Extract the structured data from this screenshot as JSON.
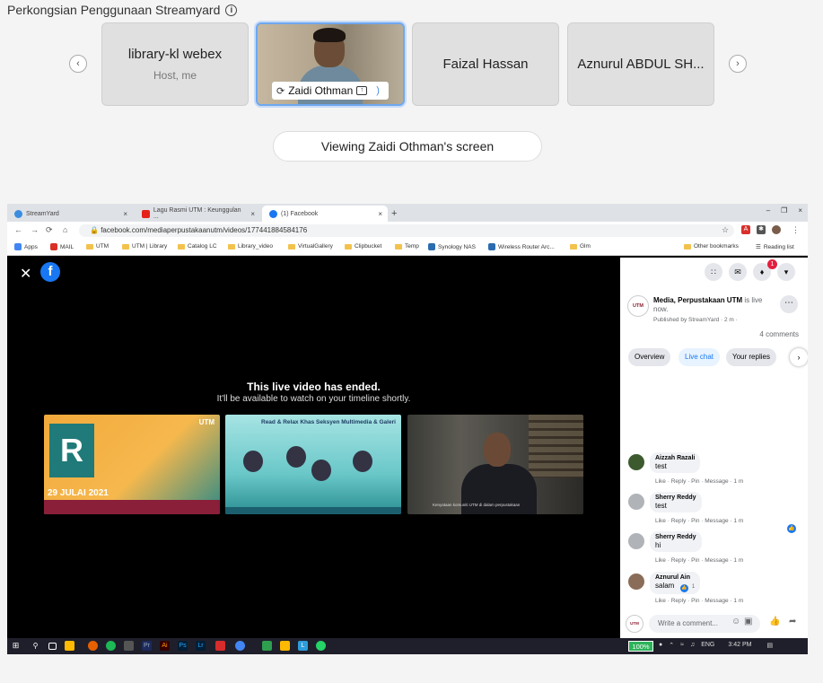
{
  "header": {
    "title": "Perkongsian Penggunaan Streamyard"
  },
  "participants": [
    {
      "name": "library-kl webex",
      "role": "Host, me"
    },
    {
      "name": "Zaidi Othman"
    },
    {
      "name": "Faizal Hassan"
    },
    {
      "name": "Aznurul ABDUL SH..."
    }
  ],
  "viewing_label": "Viewing Zaidi Othman's screen",
  "browser": {
    "tabs": [
      "StreamYard",
      "Lagu Rasmi UTM : Keunggulan ...",
      "(1) Facebook"
    ],
    "url": "facebook.com/mediaperpustakaanutm/videos/177441884584176",
    "bookmarks": [
      "Apps",
      "MAIL",
      "UTM",
      "UTM | Library",
      "Catalog LC",
      "Library_video",
      "VirtualGallery",
      "Clipbucket",
      "Temp",
      "Synology NAS",
      "Wireless Router Arc...",
      "Glm"
    ],
    "bookmarks_right": [
      "Other bookmarks",
      "Reading list"
    ]
  },
  "video": {
    "ended_title": "This live video has ended.",
    "ended_sub": "It'll be available to watch on your timeline shortly.",
    "thumb1": {
      "utm": "UTM",
      "logo": "R",
      "date": "29 JULAI 2021"
    },
    "thumb2": {
      "title": "Read & Relax Khas Seksyen Multimedia & Galeri"
    },
    "thumb3": {
      "caption": "Kenyataan komuniti UTM di dalam perpustakaan"
    }
  },
  "sidebar": {
    "notif_count": "1",
    "post": {
      "logo": "UTM",
      "author": "Media, Perpustakaan UTM",
      "status": "is live now.",
      "meta": "Published by StreamYard · 2 m ·"
    },
    "comment_count": "4 comments",
    "pills": [
      "Overview",
      "Live chat",
      "Your replies"
    ],
    "comments": [
      {
        "author": "Aizzah Razali",
        "text": "test",
        "actions": "Like · Reply · Pin · Message · 1 m"
      },
      {
        "author": "Sherry Reddy",
        "text": "test",
        "actions": "Like · Reply · Pin · Message · 1 m"
      },
      {
        "author": "Sherry Reddy",
        "text": "hi",
        "actions": "Like · Reply · Pin · Message · 1 m"
      },
      {
        "author": "Aznurul Ain",
        "text": "salam",
        "actions": "Like · Reply · Pin · Message · 1 m",
        "reactions": "1"
      }
    ],
    "write_placeholder": "Write a comment..."
  },
  "taskbar": {
    "zoom": "100%",
    "lang": "ENG",
    "time": "3:42 PM"
  },
  "colors": {
    "facebook_blue": "#1877f2",
    "active_tile_border": "#6ea8f0",
    "notif_red": "#e41e3f"
  }
}
